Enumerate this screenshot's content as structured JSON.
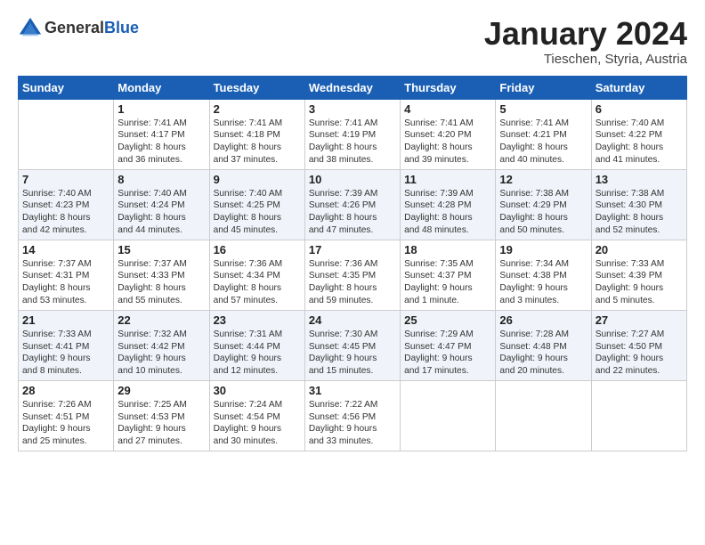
{
  "header": {
    "logo_line1": "General",
    "logo_line2": "Blue",
    "month": "January 2024",
    "location": "Tieschen, Styria, Austria"
  },
  "weekdays": [
    "Sunday",
    "Monday",
    "Tuesday",
    "Wednesday",
    "Thursday",
    "Friday",
    "Saturday"
  ],
  "weeks": [
    [
      {
        "day": "",
        "info": ""
      },
      {
        "day": "1",
        "info": "Sunrise: 7:41 AM\nSunset: 4:17 PM\nDaylight: 8 hours\nand 36 minutes."
      },
      {
        "day": "2",
        "info": "Sunrise: 7:41 AM\nSunset: 4:18 PM\nDaylight: 8 hours\nand 37 minutes."
      },
      {
        "day": "3",
        "info": "Sunrise: 7:41 AM\nSunset: 4:19 PM\nDaylight: 8 hours\nand 38 minutes."
      },
      {
        "day": "4",
        "info": "Sunrise: 7:41 AM\nSunset: 4:20 PM\nDaylight: 8 hours\nand 39 minutes."
      },
      {
        "day": "5",
        "info": "Sunrise: 7:41 AM\nSunset: 4:21 PM\nDaylight: 8 hours\nand 40 minutes."
      },
      {
        "day": "6",
        "info": "Sunrise: 7:40 AM\nSunset: 4:22 PM\nDaylight: 8 hours\nand 41 minutes."
      }
    ],
    [
      {
        "day": "7",
        "info": "Sunrise: 7:40 AM\nSunset: 4:23 PM\nDaylight: 8 hours\nand 42 minutes."
      },
      {
        "day": "8",
        "info": "Sunrise: 7:40 AM\nSunset: 4:24 PM\nDaylight: 8 hours\nand 44 minutes."
      },
      {
        "day": "9",
        "info": "Sunrise: 7:40 AM\nSunset: 4:25 PM\nDaylight: 8 hours\nand 45 minutes."
      },
      {
        "day": "10",
        "info": "Sunrise: 7:39 AM\nSunset: 4:26 PM\nDaylight: 8 hours\nand 47 minutes."
      },
      {
        "day": "11",
        "info": "Sunrise: 7:39 AM\nSunset: 4:28 PM\nDaylight: 8 hours\nand 48 minutes."
      },
      {
        "day": "12",
        "info": "Sunrise: 7:38 AM\nSunset: 4:29 PM\nDaylight: 8 hours\nand 50 minutes."
      },
      {
        "day": "13",
        "info": "Sunrise: 7:38 AM\nSunset: 4:30 PM\nDaylight: 8 hours\nand 52 minutes."
      }
    ],
    [
      {
        "day": "14",
        "info": "Sunrise: 7:37 AM\nSunset: 4:31 PM\nDaylight: 8 hours\nand 53 minutes."
      },
      {
        "day": "15",
        "info": "Sunrise: 7:37 AM\nSunset: 4:33 PM\nDaylight: 8 hours\nand 55 minutes."
      },
      {
        "day": "16",
        "info": "Sunrise: 7:36 AM\nSunset: 4:34 PM\nDaylight: 8 hours\nand 57 minutes."
      },
      {
        "day": "17",
        "info": "Sunrise: 7:36 AM\nSunset: 4:35 PM\nDaylight: 8 hours\nand 59 minutes."
      },
      {
        "day": "18",
        "info": "Sunrise: 7:35 AM\nSunset: 4:37 PM\nDaylight: 9 hours\nand 1 minute."
      },
      {
        "day": "19",
        "info": "Sunrise: 7:34 AM\nSunset: 4:38 PM\nDaylight: 9 hours\nand 3 minutes."
      },
      {
        "day": "20",
        "info": "Sunrise: 7:33 AM\nSunset: 4:39 PM\nDaylight: 9 hours\nand 5 minutes."
      }
    ],
    [
      {
        "day": "21",
        "info": "Sunrise: 7:33 AM\nSunset: 4:41 PM\nDaylight: 9 hours\nand 8 minutes."
      },
      {
        "day": "22",
        "info": "Sunrise: 7:32 AM\nSunset: 4:42 PM\nDaylight: 9 hours\nand 10 minutes."
      },
      {
        "day": "23",
        "info": "Sunrise: 7:31 AM\nSunset: 4:44 PM\nDaylight: 9 hours\nand 12 minutes."
      },
      {
        "day": "24",
        "info": "Sunrise: 7:30 AM\nSunset: 4:45 PM\nDaylight: 9 hours\nand 15 minutes."
      },
      {
        "day": "25",
        "info": "Sunrise: 7:29 AM\nSunset: 4:47 PM\nDaylight: 9 hours\nand 17 minutes."
      },
      {
        "day": "26",
        "info": "Sunrise: 7:28 AM\nSunset: 4:48 PM\nDaylight: 9 hours\nand 20 minutes."
      },
      {
        "day": "27",
        "info": "Sunrise: 7:27 AM\nSunset: 4:50 PM\nDaylight: 9 hours\nand 22 minutes."
      }
    ],
    [
      {
        "day": "28",
        "info": "Sunrise: 7:26 AM\nSunset: 4:51 PM\nDaylight: 9 hours\nand 25 minutes."
      },
      {
        "day": "29",
        "info": "Sunrise: 7:25 AM\nSunset: 4:53 PM\nDaylight: 9 hours\nand 27 minutes."
      },
      {
        "day": "30",
        "info": "Sunrise: 7:24 AM\nSunset: 4:54 PM\nDaylight: 9 hours\nand 30 minutes."
      },
      {
        "day": "31",
        "info": "Sunrise: 7:22 AM\nSunset: 4:56 PM\nDaylight: 9 hours\nand 33 minutes."
      },
      {
        "day": "",
        "info": ""
      },
      {
        "day": "",
        "info": ""
      },
      {
        "day": "",
        "info": ""
      }
    ]
  ]
}
